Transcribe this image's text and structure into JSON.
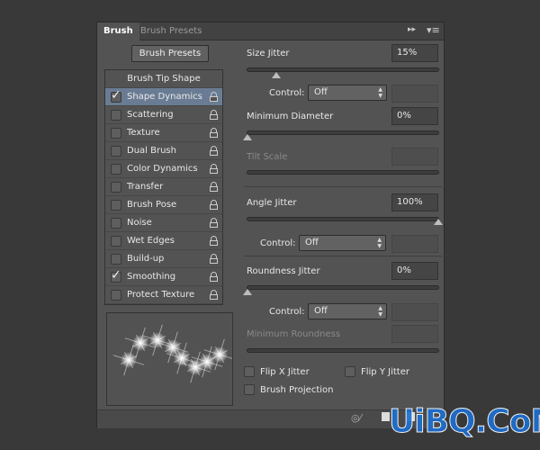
{
  "tabs": [
    {
      "label": "Brush"
    },
    {
      "label": "Brush Presets"
    }
  ],
  "brush_presets_button": "Brush Presets",
  "list_header": "Brush Tip Shape",
  "list": [
    {
      "label": "Shape Dynamics",
      "checked": true,
      "selected": true
    },
    {
      "label": "Scattering",
      "checked": false
    },
    {
      "label": "Texture",
      "checked": false
    },
    {
      "label": "Dual Brush",
      "checked": false
    },
    {
      "label": "Color Dynamics",
      "checked": false
    },
    {
      "label": "Transfer",
      "checked": false
    },
    {
      "label": "Brush Pose",
      "checked": false
    },
    {
      "label": "Noise",
      "checked": false
    },
    {
      "label": "Wet Edges",
      "checked": false
    },
    {
      "label": "Build-up",
      "checked": false
    },
    {
      "label": "Smoothing",
      "checked": true
    },
    {
      "label": "Protect Texture",
      "checked": false
    }
  ],
  "settings": {
    "size_jitter": {
      "label": "Size Jitter",
      "value": "15%",
      "slider": 15
    },
    "control_label": "Control:",
    "control1": "Off",
    "min_diameter": {
      "label": "Minimum Diameter",
      "value": "0%",
      "slider": 0
    },
    "tilt_scale": {
      "label": "Tilt Scale"
    },
    "angle_jitter": {
      "label": "Angle Jitter",
      "value": "100%",
      "slider": 100
    },
    "control2": "Off",
    "roundness_jitter": {
      "label": "Roundness Jitter",
      "value": "0%",
      "slider": 0
    },
    "control3": "Off",
    "min_roundness": {
      "label": "Minimum Roundness"
    },
    "flip_x": {
      "label": "Flip X Jitter",
      "checked": false
    },
    "flip_y": {
      "label": "Flip Y Jitter",
      "checked": false
    },
    "brush_projection": {
      "label": "Brush Projection",
      "checked": false
    }
  },
  "watermark": "UiBQ.CoM",
  "colors": {
    "selected_row": "#6a7c93",
    "panel": "#535353",
    "watermark": "#1e6fd0"
  }
}
